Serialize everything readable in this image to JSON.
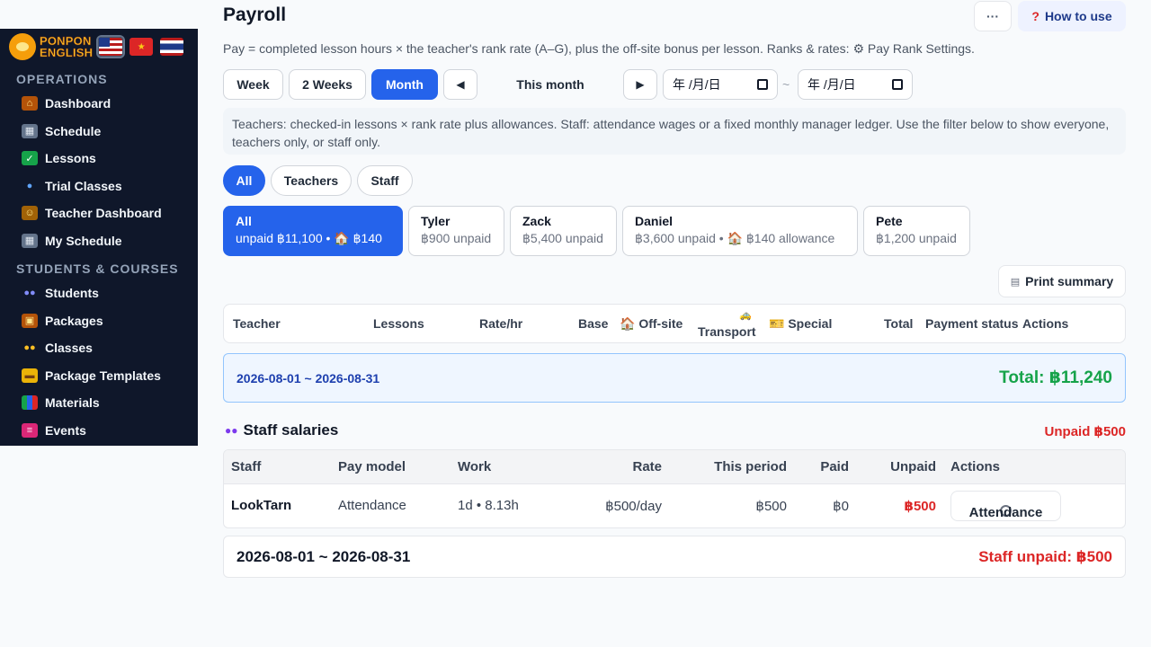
{
  "sidebar": {
    "logo_line1": "PONPON",
    "logo_line2": "ENGLISH",
    "flags": [
      "us",
      "vn",
      "th"
    ],
    "sections": [
      {
        "title": "OPERATIONS",
        "items": [
          {
            "label": "Dashboard",
            "icon": "house-icon"
          },
          {
            "label": "Schedule",
            "icon": "calendar-icon"
          },
          {
            "label": "Lessons",
            "icon": "checkbox-icon"
          },
          {
            "label": "Trial Classes",
            "icon": "magnifier-icon"
          },
          {
            "label": "Teacher Dashboard",
            "icon": "teacher-icon"
          },
          {
            "label": "My Schedule",
            "icon": "calendar-icon"
          }
        ]
      },
      {
        "title": "STUDENTS & COURSES",
        "items": [
          {
            "label": "Students",
            "icon": "people-icon"
          },
          {
            "label": "Packages",
            "icon": "box-icon"
          },
          {
            "label": "Classes",
            "icon": "group-icon"
          },
          {
            "label": "Package Templates",
            "icon": "folder-icon"
          },
          {
            "label": "Materials",
            "icon": "books-icon"
          },
          {
            "label": "Events",
            "icon": "ticket-icon"
          }
        ]
      }
    ]
  },
  "header": {
    "title": "Payroll",
    "more_label": "···",
    "how_label": "How to use",
    "description": "Pay = completed lesson hours × the teacher's rank rate (A–G), plus the off-site bonus per lesson. Ranks & rates: ⚙ Pay Rank Settings."
  },
  "period": {
    "week": "Week",
    "two_weeks": "2 Weeks",
    "month": "Month",
    "prev": "◀",
    "label": "This month",
    "next": "▶",
    "date_from": "年 /月/日",
    "date_to": "年 /月/日",
    "sep": "~"
  },
  "notice": "Teachers: checked-in lessons × rank rate plus allowances. Staff: attendance wages or a fixed monthly manager ledger. Use the filter below to show everyone, teachers only, or staff only.",
  "filters": [
    "All",
    "Teachers",
    "Staff"
  ],
  "cards": [
    {
      "name": "All",
      "sub": "unpaid ฿11,100  •  🏠 ฿140"
    },
    {
      "name": "Tyler",
      "sub": "฿900 unpaid"
    },
    {
      "name": "Zack",
      "sub": "฿5,400 unpaid"
    },
    {
      "name": "Daniel",
      "sub": "฿3,600 unpaid  •  🏠 ฿140 allowance"
    },
    {
      "name": "Pete",
      "sub": "฿1,200 unpaid"
    }
  ],
  "print_label": "Print summary",
  "table": {
    "headers": {
      "teacher": "Teacher",
      "lessons": "Lessons",
      "rate": "Rate/hr",
      "base": "Base",
      "offsite": "🏠 Off-site",
      "transport_icon": "🚕",
      "transport": "Transport",
      "special": "🎫 Special",
      "total": "Total",
      "payment_status": "Payment status",
      "actions": "Actions"
    }
  },
  "teacher_period": {
    "range": "2026-08-01 ~ 2026-08-31",
    "total": "Total: ฿11,240"
  },
  "staff": {
    "title": "Staff salaries",
    "unpaid": "Unpaid ฿500",
    "headers": [
      "Staff",
      "Pay model",
      "Work",
      "Rate",
      "This period",
      "Paid",
      "Unpaid",
      "Actions"
    ],
    "rows": [
      {
        "staff": "LookTarn",
        "model": "Attendance",
        "work": "1d  •  8.13h",
        "rate": "฿500/day",
        "period": "฿500",
        "paid": "฿0",
        "unpaid": "฿500",
        "action": "Attendance"
      }
    ],
    "footer_range": "2026-08-01 ~ 2026-08-31",
    "footer_unpaid": "Staff unpaid: ฿500"
  },
  "colors": {
    "primary": "#2563eb",
    "sidebar_bg": "#0f172a",
    "total_green": "#16a34a",
    "unpaid_red": "#dc2626"
  }
}
